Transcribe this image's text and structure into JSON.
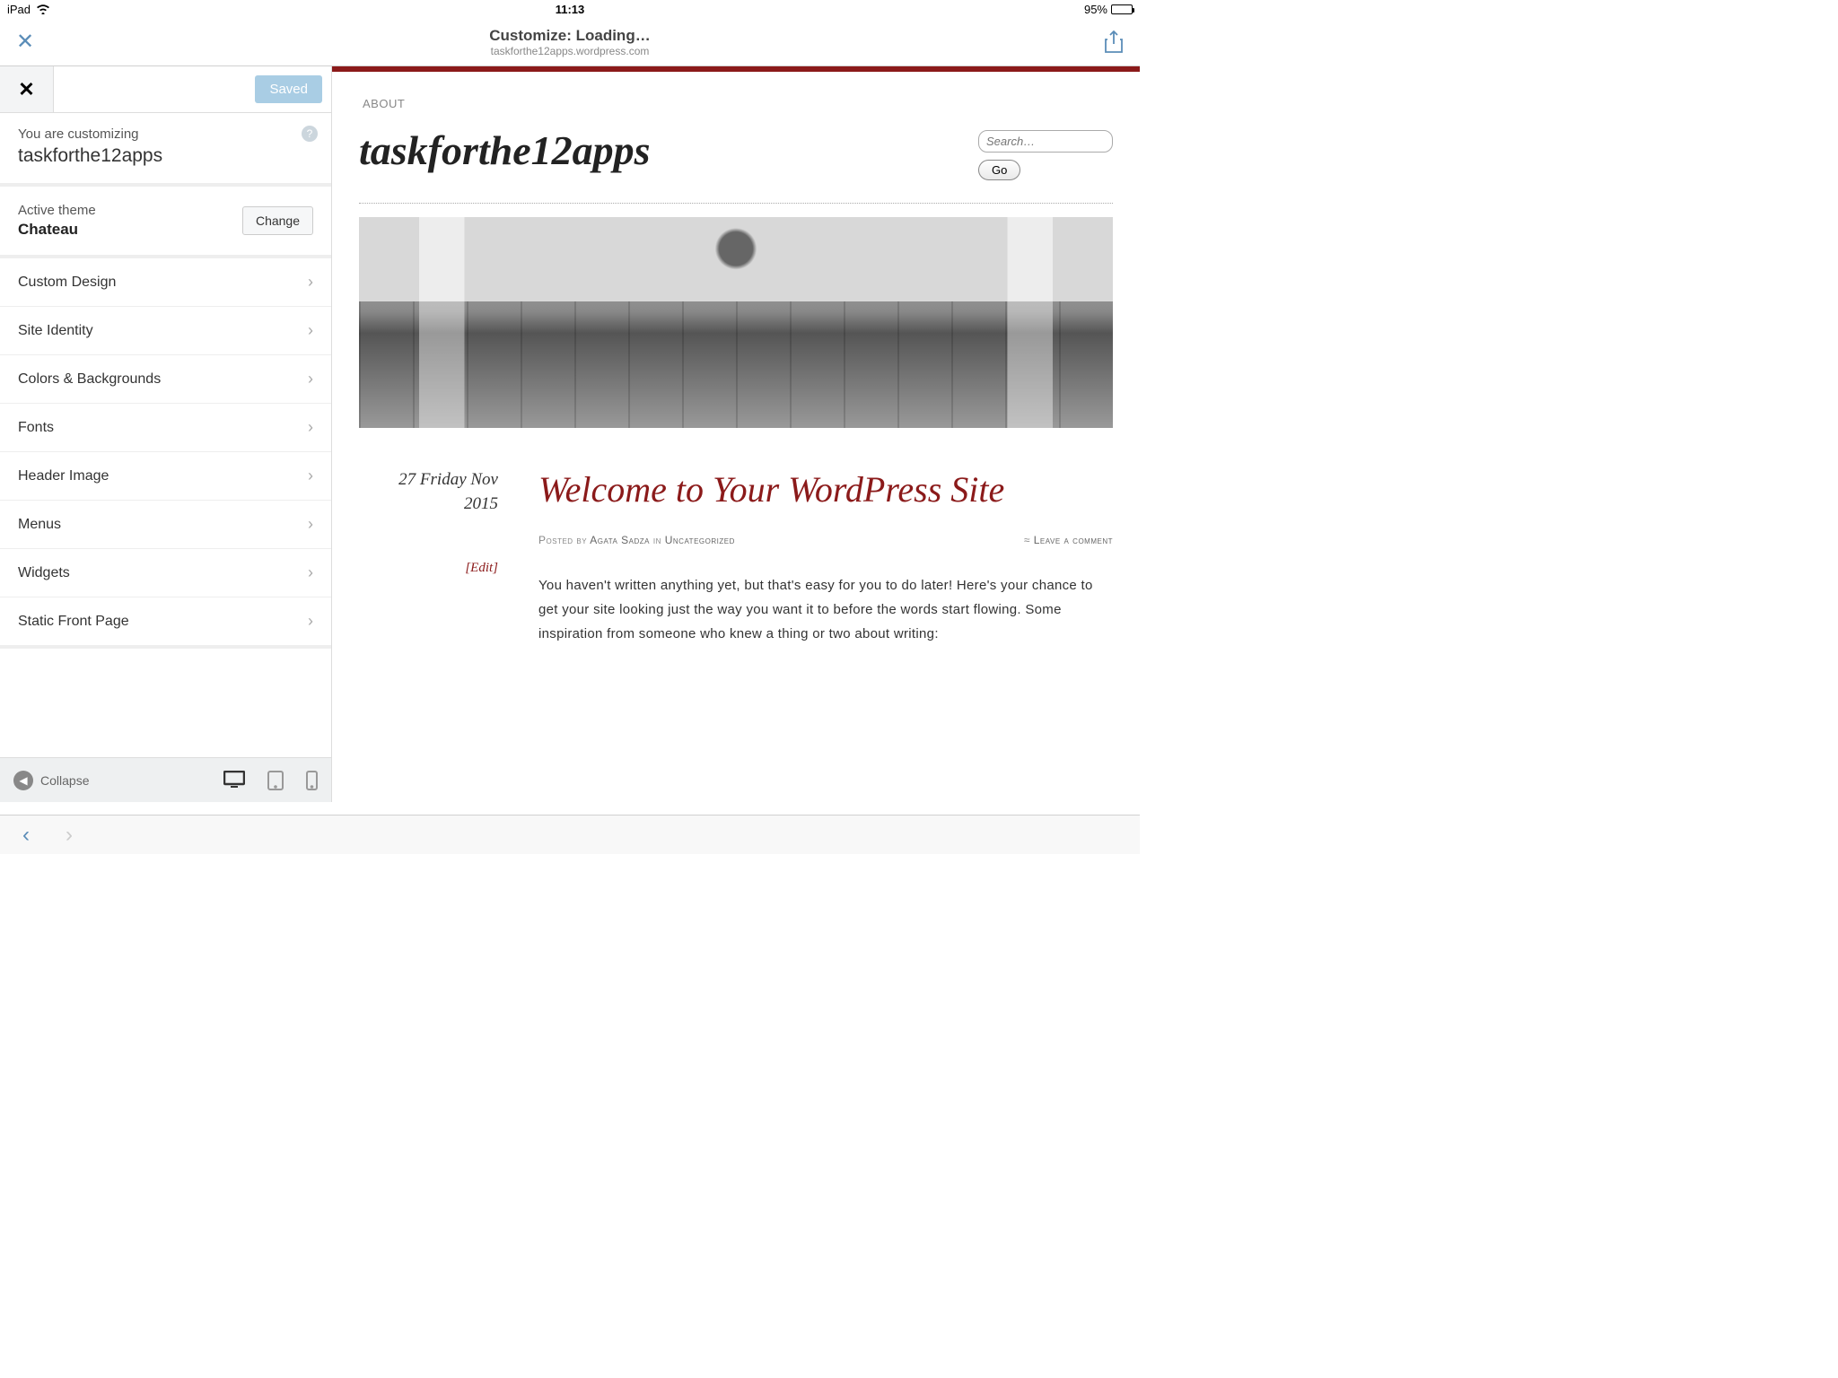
{
  "status": {
    "device": "iPad",
    "time": "11:13",
    "battery": "95%"
  },
  "chrome": {
    "title": "Customize: Loading…",
    "subtitle": "taskforthe12apps.wordpress.com"
  },
  "customizer": {
    "saved_label": "Saved",
    "customizing_label": "You are customizing",
    "site_name": "taskforthe12apps",
    "active_theme_label": "Active theme",
    "theme_name": "Chateau",
    "change_label": "Change",
    "items": [
      "Custom Design",
      "Site Identity",
      "Colors & Backgrounds",
      "Fonts",
      "Header Image",
      "Menus",
      "Widgets",
      "Static Front Page"
    ],
    "collapse_label": "Collapse"
  },
  "preview": {
    "about_label": "ABOUT",
    "site_title": "taskforthe12apps",
    "search_placeholder": "Search…",
    "go_label": "Go",
    "post_date_line1": "27 Friday Nov",
    "post_date_line2": "2015",
    "post_title": "Welcome to Your WordPress Site",
    "posted_by": "Posted by",
    "author": "Agata Sadza",
    "in_label": "in",
    "category": "Uncategorized",
    "leave_comment": "Leave a comment",
    "edit_label": "[Edit]",
    "body": "You haven't written anything yet, but that's easy for you to do later! Here's your chance to get your site looking just the way you want it to before the words start flowing. Some inspiration from someone who knew a thing or two about writing:"
  }
}
